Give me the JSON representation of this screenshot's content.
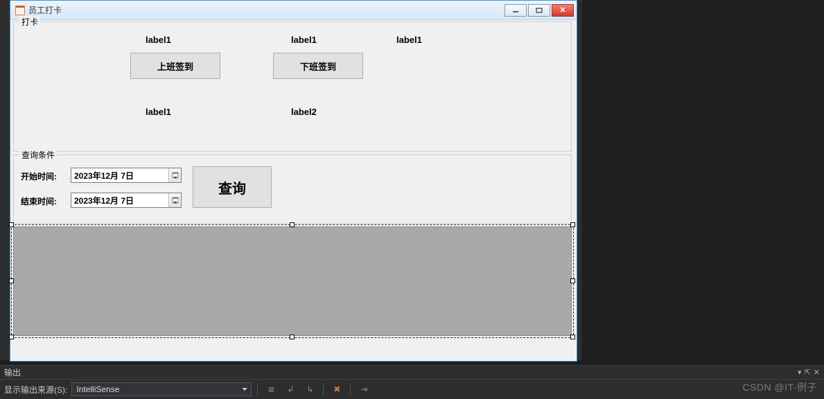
{
  "window": {
    "title": "员工打卡",
    "min_tip": "最小化",
    "max_tip": "最大化",
    "close_tip": "关闭"
  },
  "group1": {
    "legend": "打卡",
    "label_top1": "label1",
    "label_top2": "label1",
    "label_top3": "label1",
    "btn_signin": "上班签到",
    "btn_signout": "下班签到",
    "label_bot1": "label1",
    "label_bot2": "label2"
  },
  "group2": {
    "legend": "查询条件",
    "start_label": "开始时间:",
    "end_label": "结束时间:",
    "start_value": "2023年12月  7日",
    "end_value": "2023年12月  7日",
    "query_btn": "查询"
  },
  "output": {
    "title": "输出",
    "source_label": "显示输出来源(S):",
    "source_value": "IntelliSense"
  },
  "watermark": "CSDN @IT-例子"
}
